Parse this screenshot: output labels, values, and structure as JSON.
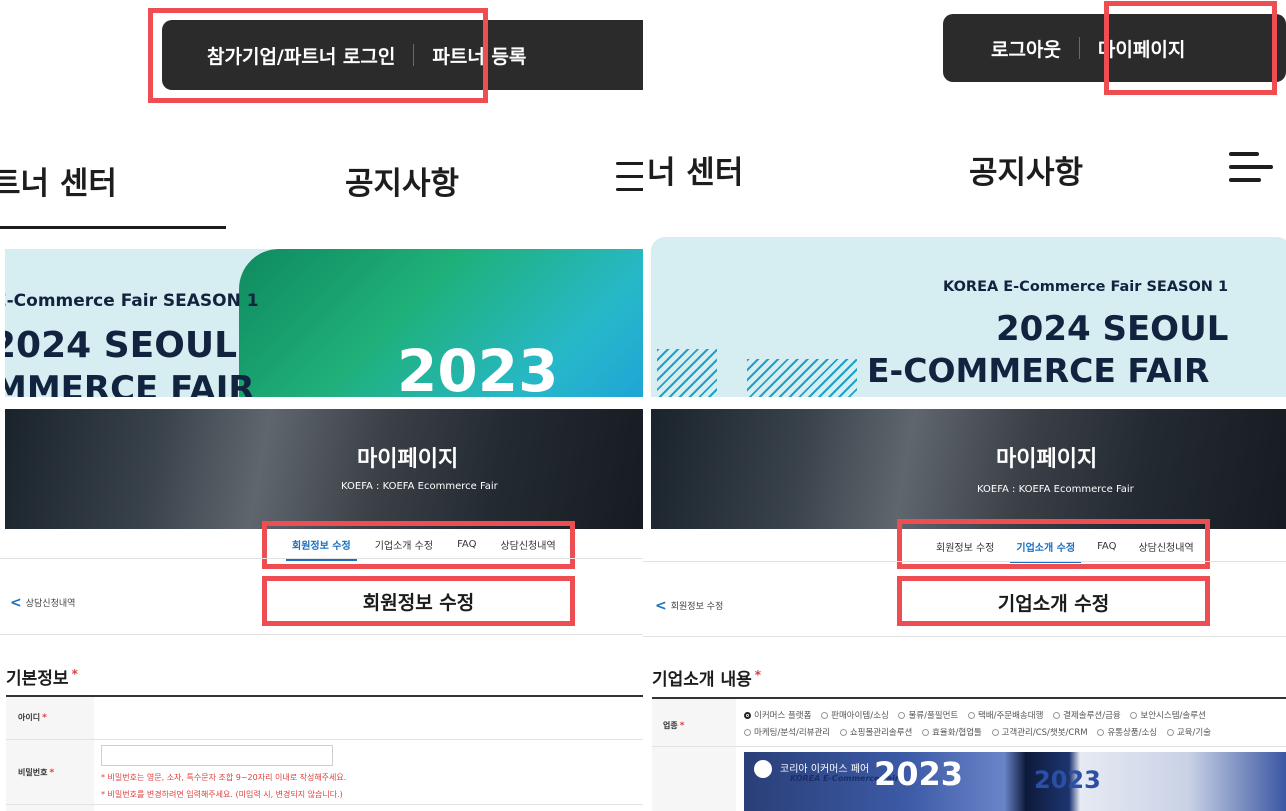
{
  "left": {
    "topbar": {
      "login": "참가기업/파트너 로그인",
      "register": "파트너 등록"
    },
    "nav": {
      "partner_center": "트너 센터",
      "notice": "공지사항"
    },
    "banner": {
      "line1": "E-Commerce Fair SEASON 1",
      "line2": "2024 SEOUL",
      "line3": "MMERCE FAIR",
      "year": "2023"
    },
    "hero": {
      "title": "마이페이지",
      "subtitle": "KOEFA : KOEFA Ecommerce Fair"
    },
    "tabs": [
      "회원정보 수정",
      "기업소개 수정",
      "FAQ",
      "상담신청내역"
    ],
    "back_label": "상담신청내역",
    "page_title": "회원정보 수정",
    "section_title": "기본정보",
    "fields": {
      "id_label": "아이디",
      "pw_label": "비밀번호"
    },
    "hints": [
      "* 비밀번호는 영문, 소자, 특수문자 조합 9~20자리 이내로 작성해주세요.",
      "* 비밀번호를 변경하려면 입력해주세요. (미입력 시, 변경되지 않습니다.)"
    ]
  },
  "right": {
    "topbar": {
      "logout": "로그아웃",
      "mypage": "마이페이지"
    },
    "nav": {
      "partner_center": "너 센터",
      "notice": "공지사항"
    },
    "banner": {
      "line1": "KOREA E-Commerce Fair SEASON 1",
      "line2": "2024 SEOUL",
      "line3": "E-COMMERCE FAIR"
    },
    "hero": {
      "title": "마이페이지",
      "subtitle": "KOEFA : KOEFA Ecommerce Fair"
    },
    "tabs": [
      "회원정보 수정",
      "기업소개 수정",
      "FAQ",
      "상담신청내역"
    ],
    "back_label": "회원정보 수정",
    "page_title": "기업소개 수정",
    "section_title": "기업소개 내용",
    "industry_label": "업종",
    "industry_row1": [
      "이커머스 플랫폼",
      "판매아이템/소싱",
      "물류/풀필먼트",
      "택배/주문배송대행",
      "결제솔루션/금융",
      "보안시스템/솔루션"
    ],
    "industry_row2": [
      "마케팅/분석/리뷰관리",
      "쇼핑몰관리솔루션",
      "효율화/협업툴",
      "고객관리/CS/챗봇/CRM",
      "유통상품/소싱",
      "교육/기술"
    ],
    "image_text": {
      "caption1": "코리아 이커머스 페어",
      "caption2": "KOREA E-Commerce Fair",
      "year": "2023",
      "year2": "2023"
    }
  },
  "colors": {
    "highlight": "#ee4d52",
    "accent": "#1a6fc0",
    "topbar_bg": "#2b2b2b",
    "banner_bg": "#d6eef2",
    "required": "#e03c3c"
  }
}
